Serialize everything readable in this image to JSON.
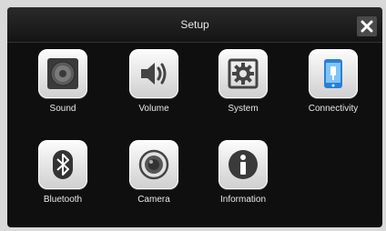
{
  "header": {
    "title": "Setup"
  },
  "tiles": [
    {
      "label": "Sound",
      "icon": "speaker-icon"
    },
    {
      "label": "Volume",
      "icon": "volume-icon"
    },
    {
      "label": "System",
      "icon": "gear-icon"
    },
    {
      "label": "Connectivity",
      "icon": "phone-connect-icon"
    },
    {
      "label": "Bluetooth",
      "icon": "bluetooth-icon"
    },
    {
      "label": "Camera",
      "icon": "camera-icon"
    },
    {
      "label": "Information",
      "icon": "info-icon"
    }
  ],
  "colors": {
    "accent_blue": "#2a7fd4",
    "background": "#0f0f0f"
  }
}
